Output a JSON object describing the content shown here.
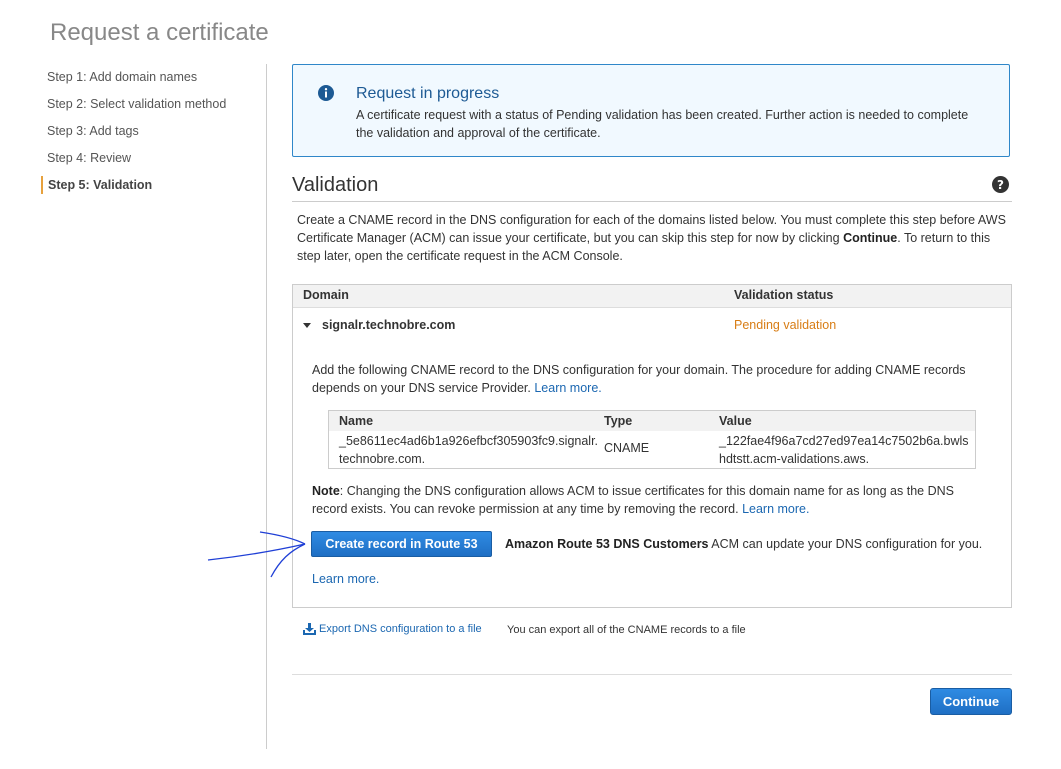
{
  "page": {
    "title": "Request a certificate"
  },
  "steps": [
    {
      "label": "Step 1: Add domain names"
    },
    {
      "label": "Step 2: Select validation method"
    },
    {
      "label": "Step 3: Add tags"
    },
    {
      "label": "Step 4: Review"
    },
    {
      "label": "Step 5: Validation",
      "active": true
    }
  ],
  "alert": {
    "icon": "info-icon",
    "title": "Request in progress",
    "body": "A certificate request with a status of Pending validation has been created. Further action is needed to complete the validation and approval of the certificate."
  },
  "validation": {
    "title": "Validation",
    "help_icon": "help-icon",
    "intro_part1": "Create a CNAME record in the DNS configuration for each of the domains listed below. You must complete this step before AWS Certificate Manager (ACM) can issue your certificate, but you can skip this step for now by clicking ",
    "intro_bold": "Continue",
    "intro_part2": ". To return to this step later, open the certificate request in the ACM Console.",
    "table": {
      "headers": {
        "domain": "Domain",
        "status": "Validation status"
      },
      "row": {
        "domain": "signalr.technobre.com",
        "status": "Pending validation",
        "status_color": "#d87d15",
        "instructions": "Add the following CNAME record to the DNS configuration for your domain. The procedure for adding CNAME records depends on your DNS service Provider.",
        "learn_more": "Learn more.",
        "cname": {
          "headers": {
            "name": "Name",
            "type": "Type",
            "value": "Value"
          },
          "name": "_5e8611ec4ad6b1a926efbcf305903fc9.signalr.technobre.com.",
          "type": "CNAME",
          "value": "_122fae4f96a7cd27ed97ea14c7502b6a.bwlshdtstt.acm-validations.aws."
        },
        "note_label": "Note",
        "note_text": ": Changing the DNS configuration allows ACM to issue certificates for this domain name for as long as the DNS record exists. You can revoke permission at any time by removing the record.",
        "note_learn_more": "Learn more.",
        "route53_button": "Create record in Route 53",
        "route53_bold": "Amazon Route 53 DNS Customers",
        "route53_text": " ACM can update your DNS configuration for you.",
        "route53_learn_more": "Learn more."
      }
    },
    "export_link": "Export DNS configuration to a file",
    "export_note": "You can export all of the CNAME records to a file"
  },
  "footer": {
    "continue_label": "Continue"
  },
  "colors": {
    "accent": "#1f6fc4",
    "link": "#1b67b1",
    "pending": "#d87d15",
    "alert_border": "#2f87c9",
    "step_marker": "#e7a13d",
    "annotation": "#1f3fd6"
  }
}
